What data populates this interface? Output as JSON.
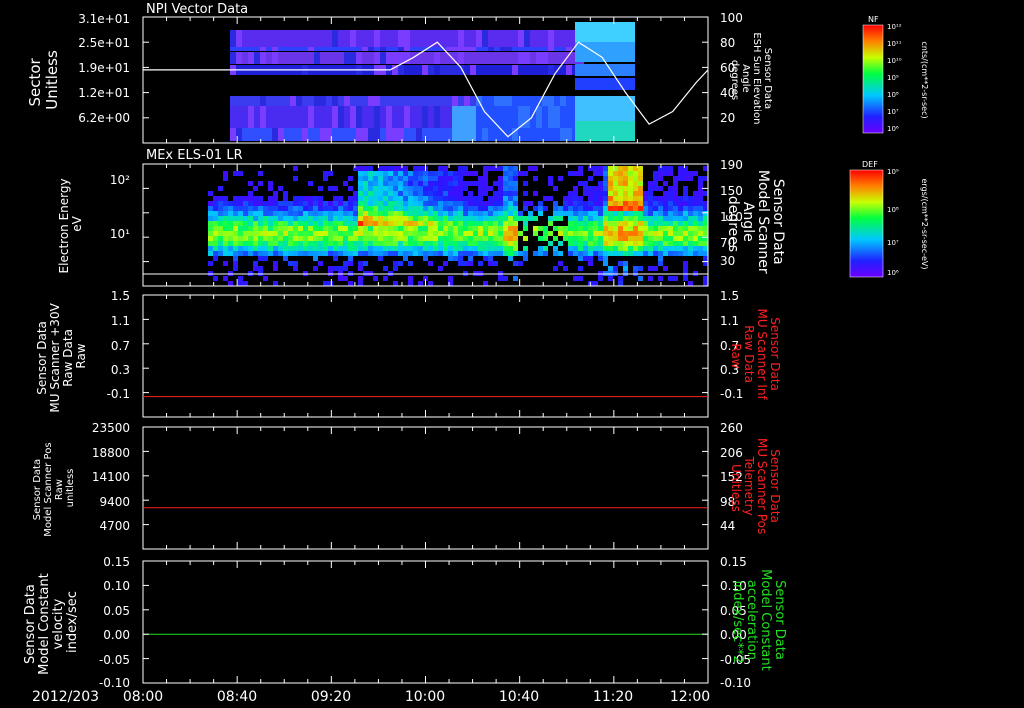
{
  "colors": {
    "background": "#000000",
    "axes": "#ffffff",
    "red_trace": "#ff2020",
    "green_trace": "#20e020",
    "white_trace": "#ffffff"
  },
  "x_axis": {
    "date_label": "2012/203",
    "tick_labels": [
      "08:00",
      "08:40",
      "09:20",
      "10:00",
      "10:40",
      "11:20",
      "12:00"
    ],
    "range": [
      "08:00",
      "12:00"
    ]
  },
  "chart_data": [
    {
      "type": "heatmap",
      "panel_title": "NPI Vector Data",
      "left_axis_label": [
        "Sector",
        "Unitless"
      ],
      "left_ticks": [
        "3.1e+01",
        "2.5e+01",
        "1.9e+01",
        "1.2e+01",
        "6.2e+00"
      ],
      "right_axis_label": [
        "Sensor Data",
        "ESH Sun Elevation",
        "Angle",
        "degrees"
      ],
      "right_ticks": [
        "100",
        "80",
        "60",
        "40",
        "20"
      ],
      "right_ylim": [
        0,
        100
      ],
      "colorbar": {
        "title": "NF",
        "units": "cnts/(cm**2-sr-sec)",
        "tick_labels": [
          "10¹²",
          "10¹¹",
          "10¹⁰",
          "10⁹",
          "10⁸",
          "10⁷",
          "10⁶"
        ]
      },
      "overlay_line": {
        "x": [
          "08:00",
          "09:45",
          "09:55",
          "10:05",
          "10:15",
          "10:25",
          "10:35",
          "10:45",
          "10:55",
          "11:05",
          "11:15",
          "11:25",
          "11:35",
          "11:45",
          "11:55",
          "12:00"
        ],
        "y": [
          58,
          58,
          68,
          80,
          60,
          25,
          5,
          20,
          55,
          80,
          68,
          40,
          15,
          25,
          48,
          58
        ]
      }
    },
    {
      "type": "heatmap",
      "panel_title": "MEx ELS-01 LR",
      "left_axis_label": [
        "Electron Energy",
        "eV"
      ],
      "left_ticks": [
        "10²",
        "10¹"
      ],
      "right_axis_label": [
        "Sensor Data",
        "Model Scanner",
        "Angle",
        "degrees"
      ],
      "right_ticks": [
        "190",
        "150",
        "110",
        "70",
        "30"
      ],
      "right_ylim": [
        10,
        190
      ],
      "colorbar": {
        "title": "DEF",
        "units": "ergs/(cm**2-sr-sec-eV)",
        "tick_labels": [
          "10⁹",
          "10⁸",
          "10⁷",
          "10⁶"
        ]
      }
    },
    {
      "type": "line",
      "left_axis_label": [
        "Sensor Data",
        "MU Scanner +30V",
        "Raw Data",
        "Raw"
      ],
      "left_ticks": [
        "1.5",
        "1.1",
        "0.7",
        "0.3",
        "-0.1"
      ],
      "right_axis_label": [
        "Sensor Data",
        "MU Scanner Inf",
        "Raw Data",
        "Raw"
      ],
      "right_ticks": [
        "1.5",
        "1.1",
        "0.7",
        "0.3",
        "-0.1"
      ],
      "ylim": [
        -0.3,
        1.5
      ],
      "series": [
        {
          "color": "red",
          "x": [
            "08:00",
            "12:00"
          ],
          "y": [
            0.0,
            0.0
          ]
        }
      ]
    },
    {
      "type": "line",
      "left_axis_label": [
        "Sensor Data",
        "Model Scanner Pos",
        "Raw",
        "unitless"
      ],
      "left_ticks": [
        "23500",
        "18800",
        "14100",
        "9400",
        "4700"
      ],
      "right_axis_label": [
        "Sensor Data",
        "MU Scanner Pos",
        "Telemetry",
        "Unitless"
      ],
      "right_ticks": [
        "260",
        "206",
        "152",
        "98",
        "44"
      ],
      "ylim": [
        0,
        23500
      ],
      "series": [
        {
          "color": "red",
          "x": [
            "08:00",
            "12:00"
          ],
          "y": [
            7950,
            7950
          ]
        }
      ]
    },
    {
      "type": "line",
      "left_axis_label": [
        "Sensor Data",
        "Model Constant",
        "velocity",
        "index/sec"
      ],
      "left_ticks": [
        "0.15",
        "0.10",
        "0.05",
        "0.00",
        "-0.05",
        "-0.10"
      ],
      "right_axis_label": [
        "Sensor Data",
        "Model Constant",
        "acceleration",
        "index/sec**2"
      ],
      "right_ticks": [
        "0.15",
        "0.10",
        "0.05",
        "0.00",
        "-0.05",
        "-0.10"
      ],
      "ylim": [
        -0.1,
        0.15
      ],
      "series": [
        {
          "color": "green",
          "x": [
            "08:00",
            "12:00"
          ],
          "y": [
            0.0,
            0.0
          ]
        }
      ]
    }
  ]
}
